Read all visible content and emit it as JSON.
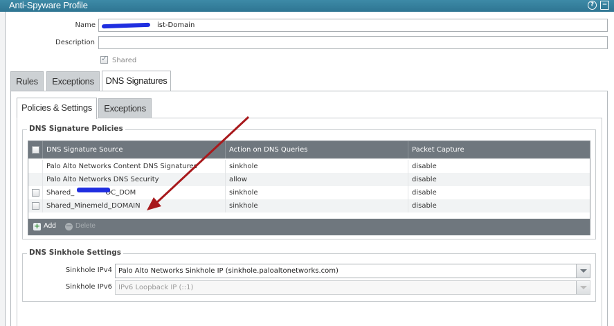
{
  "window": {
    "title": "Anti-Spyware Profile"
  },
  "form": {
    "name_label": "Name",
    "name_value": "ist-Domain",
    "description_label": "Description",
    "description_value": "",
    "shared_label": "Shared",
    "shared_checked": true
  },
  "tabs": [
    {
      "label": "Rules",
      "active": false
    },
    {
      "label": "Exceptions",
      "active": false
    },
    {
      "label": "DNS Signatures",
      "active": true
    }
  ],
  "subtabs": [
    {
      "label": "Policies & Settings",
      "active": true
    },
    {
      "label": "Exceptions",
      "active": false
    }
  ],
  "policies": {
    "legend": "DNS Signature Policies",
    "columns": [
      "DNS Signature Source",
      "Action on DNS Queries",
      "Packet Capture"
    ],
    "rows": [
      {
        "source": "Palo Alto Networks Content DNS Signatures",
        "action": "sinkhole",
        "capture": "disable",
        "has_checkbox": false
      },
      {
        "source": "Palo Alto Networks DNS Security",
        "action": "allow",
        "capture": "disable",
        "has_checkbox": false
      },
      {
        "source": "Shared_",
        "source_suffix": "OC_DOM",
        "action": "sinkhole",
        "capture": "disable",
        "has_checkbox": true
      },
      {
        "source": "Shared_Minemeld_DOMAIN",
        "action": "sinkhole",
        "capture": "disable",
        "has_checkbox": true
      }
    ],
    "add_label": "Add",
    "delete_label": "Delete"
  },
  "sinkhole": {
    "legend": "DNS Sinkhole Settings",
    "ipv4_label": "Sinkhole IPv4",
    "ipv4_value": "Palo Alto Networks Sinkhole IP (sinkhole.paloaltonetworks.com)",
    "ipv6_label": "Sinkhole IPv6",
    "ipv6_value": "IPv6 Loopback IP (::1)"
  },
  "colors": {
    "titlebar": "#2e7592",
    "grid_header": "#6f777e",
    "annotation_arrow": "#a8191c"
  }
}
